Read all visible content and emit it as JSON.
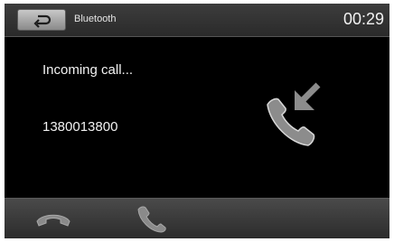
{
  "header": {
    "title": "Bluetooth",
    "clock": "00:29"
  },
  "call": {
    "status": "Incoming call...",
    "number": "1380013800"
  },
  "icons": {
    "back": "back-arrow-icon",
    "incoming": "incoming-call-icon",
    "hangup": "hang-up-icon",
    "answer": "answer-call-icon"
  },
  "colors": {
    "background": "#000000",
    "header": "#333333",
    "text": "#f2f2f2",
    "icon": "#8c8c8c"
  }
}
